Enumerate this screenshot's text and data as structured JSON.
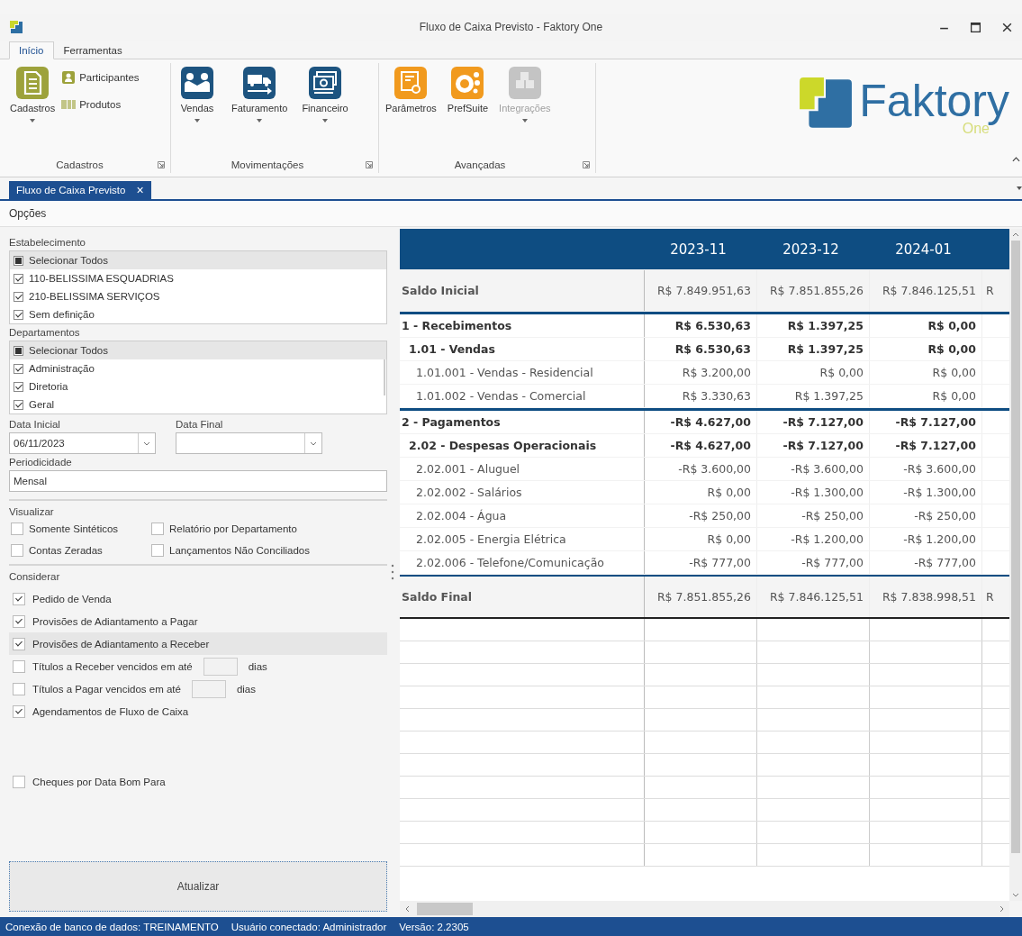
{
  "window": {
    "title": "Fluxo de Caixa Previsto - Faktory One"
  },
  "ribbon_tabs": [
    {
      "label": "Início",
      "selected": true
    },
    {
      "label": "Ferramentas",
      "selected": false
    }
  ],
  "ribbon_groups": [
    {
      "title": "Cadastros",
      "buttons": [
        {
          "kind": "large",
          "label": "Cadastros",
          "dropdown": true,
          "disabled": false
        },
        {
          "kind": "small",
          "label": "Participantes",
          "dropdown": false,
          "disabled": false
        },
        {
          "kind": "small",
          "label": "Produtos",
          "dropdown": false,
          "disabled": false
        }
      ]
    },
    {
      "title": "Movimentações",
      "buttons": [
        {
          "kind": "large",
          "label": "Vendas",
          "dropdown": true,
          "disabled": false
        },
        {
          "kind": "large",
          "label": "Faturamento",
          "dropdown": true,
          "disabled": false
        },
        {
          "kind": "large",
          "label": "Financeiro",
          "dropdown": true,
          "disabled": false
        }
      ]
    },
    {
      "title": "Avançadas",
      "buttons": [
        {
          "kind": "large",
          "label": "Parâmetros",
          "dropdown": false,
          "disabled": false
        },
        {
          "kind": "large",
          "label": "PrefSuite",
          "dropdown": false,
          "disabled": false
        },
        {
          "kind": "large",
          "label": "Integrações",
          "dropdown": true,
          "disabled": true
        }
      ]
    }
  ],
  "logo": {
    "name": "Faktory",
    "tagline": "One"
  },
  "document_tabs": [
    {
      "label": "Fluxo de Caixa Previsto",
      "close": "×",
      "selected": true
    }
  ],
  "options_menu": "Opções",
  "filters": {
    "establishments": {
      "label": "Estabelecimento",
      "items": [
        {
          "kind": "select_all",
          "label": "Selecionar Todos",
          "checked": true
        },
        {
          "kind": "item",
          "label": "110-BELISSIMA ESQUADRIAS",
          "checked": true
        },
        {
          "kind": "item",
          "label": "210-BELISSIMA SERVIÇOS",
          "checked": true
        },
        {
          "kind": "item",
          "label": "Sem definição",
          "checked": true
        }
      ]
    },
    "departments": {
      "label": "Departamentos",
      "items": [
        {
          "kind": "select_all",
          "label": "Selecionar Todos",
          "checked": true
        },
        {
          "kind": "item",
          "label": "Administração",
          "checked": true
        },
        {
          "kind": "item",
          "label": "Diretoria",
          "checked": true
        },
        {
          "kind": "item",
          "label": "Geral",
          "checked": true
        }
      ]
    },
    "start_date": {
      "label": "Data Inicial",
      "value": "06/11/2023"
    },
    "end_date": {
      "label": "Data Final"
    },
    "periodicity": {
      "label": "Periodicidade",
      "value": "Mensal"
    },
    "view": {
      "label": "Visualizar",
      "options": [
        {
          "label": "Somente Sintéticos",
          "checked": false
        },
        {
          "label": "Relatório por Departamento",
          "checked": false
        },
        {
          "label": "Contas Zeradas",
          "checked": false
        },
        {
          "label": "Lançamentos Não Conciliados",
          "checked": false
        }
      ]
    },
    "consider": {
      "label": "Considerar",
      "options": [
        {
          "kind": "check",
          "label": "Pedido de Venda",
          "checked": true,
          "selected": false
        },
        {
          "kind": "check",
          "label": "Provisões de Adiantamento a Pagar",
          "checked": true,
          "selected": false
        },
        {
          "kind": "check",
          "label": "Provisões de Adiantamento a Receber",
          "checked": true,
          "selected": true
        },
        {
          "kind": "days",
          "label": "Títulos a Receber vencidos em até",
          "unit": "dias",
          "checked": false,
          "selected": false
        },
        {
          "kind": "days",
          "label": "Títulos a Pagar vencidos em até",
          "unit": "dias",
          "checked": false,
          "selected": false
        },
        {
          "kind": "check",
          "label": "Agendamentos de Fluxo de Caixa",
          "checked": true,
          "selected": false
        },
        {
          "kind": "spaced",
          "label": "Cheques por Data Bom Para",
          "checked": false,
          "selected": false
        }
      ]
    },
    "update_button": "Atualizar"
  },
  "grid": {
    "columns": [
      "2023-11",
      "2023-12",
      "2024-01"
    ],
    "rows": [
      {
        "kind": "balance",
        "label": "Saldo Inicial",
        "values": [
          "R$ 7.849.951,63",
          "R$ 7.851.855,26",
          "R$ 7.846.125,51",
          "R"
        ]
      },
      {
        "kind": "group",
        "label": "1 - Recebimentos",
        "values": [
          "R$ 6.530,63",
          "R$ 1.397,25",
          "R$ 0,00"
        ]
      },
      {
        "kind": "subgroup",
        "label": "1.01 - Vendas",
        "values": [
          "R$ 6.530,63",
          "R$ 1.397,25",
          "R$ 0,00"
        ]
      },
      {
        "kind": "account",
        "label": "1.01.001 - Vendas - Residencial",
        "values": [
          "R$ 3.200,00",
          "R$ 0,00",
          "R$ 0,00"
        ]
      },
      {
        "kind": "account",
        "label": "1.01.002 - Vendas - Comercial",
        "values": [
          "R$ 3.330,63",
          "R$ 1.397,25",
          "R$ 0,00"
        ]
      },
      {
        "kind": "group",
        "label": "2 - Pagamentos",
        "values": [
          "-R$ 4.627,00",
          "-R$ 7.127,00",
          "-R$ 7.127,00"
        ]
      },
      {
        "kind": "subgroup",
        "label": "2.02 - Despesas Operacionais",
        "values": [
          "-R$ 4.627,00",
          "-R$ 7.127,00",
          "-R$ 7.127,00"
        ]
      },
      {
        "kind": "account",
        "label": "2.02.001 - Aluguel",
        "values": [
          "-R$ 3.600,00",
          "-R$ 3.600,00",
          "-R$ 3.600,00"
        ]
      },
      {
        "kind": "account",
        "label": "2.02.002 - Salários",
        "values": [
          "R$ 0,00",
          "-R$ 1.300,00",
          "-R$ 1.300,00"
        ]
      },
      {
        "kind": "account",
        "label": "2.02.004 - Água",
        "values": [
          "-R$ 250,00",
          "-R$ 250,00",
          "-R$ 250,00"
        ]
      },
      {
        "kind": "account",
        "label": "2.02.005 - Energia Elétrica",
        "values": [
          "R$ 0,00",
          "-R$ 1.200,00",
          "-R$ 1.200,00"
        ]
      },
      {
        "kind": "account",
        "label": "2.02.006 - Telefone/Comunicação",
        "values": [
          "-R$ 777,00",
          "-R$ 777,00",
          "-R$ 777,00"
        ]
      },
      {
        "kind": "balance",
        "label": "Saldo Final",
        "values": [
          "R$ 7.851.855,26",
          "R$ 7.846.125,51",
          "R$ 7.838.998,51",
          "R"
        ]
      }
    ]
  },
  "status_bar": [
    "Conexão de banco de dados: TREINAMENTO",
    "Usuário conectado: Administrador",
    "Versão: 2.2305"
  ]
}
